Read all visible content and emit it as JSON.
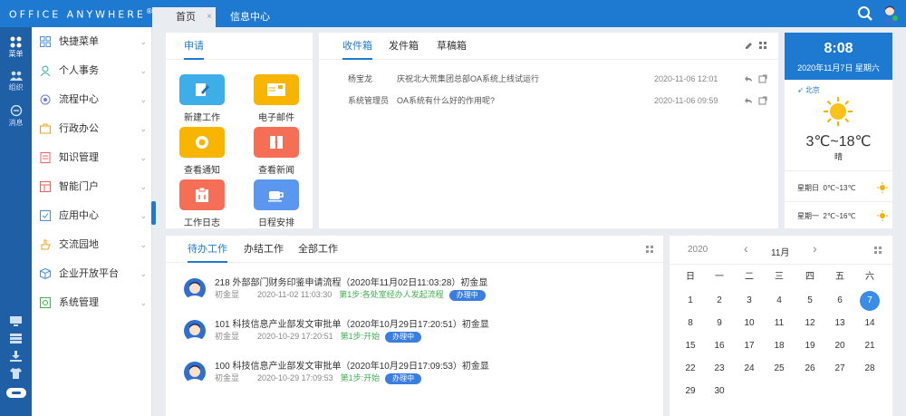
{
  "app": {
    "logo": "OFFICE ANYWHERE",
    "logo_mark": "®"
  },
  "tabs": [
    {
      "label": "首页"
    },
    {
      "label": "信息中心"
    }
  ],
  "leftbar": {
    "items": [
      {
        "label": "菜单"
      },
      {
        "label": "组织"
      },
      {
        "label": "消息"
      }
    ]
  },
  "menu": {
    "items": [
      {
        "label": "快捷菜单",
        "icon": "grid-icon"
      },
      {
        "label": "个人事务",
        "icon": "user-icon"
      },
      {
        "label": "流程中心",
        "icon": "flow-icon"
      },
      {
        "label": "行政办公",
        "icon": "briefcase-icon"
      },
      {
        "label": "知识管理",
        "icon": "book-icon"
      },
      {
        "label": "智能门户",
        "icon": "portal-icon"
      },
      {
        "label": "应用中心",
        "icon": "app-icon"
      },
      {
        "label": "交流园地",
        "icon": "hand-icon"
      },
      {
        "label": "企业开放平台",
        "icon": "cube-icon"
      },
      {
        "label": "系统管理",
        "icon": "settings-icon"
      }
    ]
  },
  "apply": {
    "tab": "申请",
    "apps": [
      {
        "label": "新建工作",
        "color": "#3eaee8"
      },
      {
        "label": "电子邮件",
        "color": "#f7b500"
      },
      {
        "label": "查看通知",
        "color": "#f7b500"
      },
      {
        "label": "查看新闻",
        "color": "#f46f56"
      },
      {
        "label": "工作日志",
        "color": "#f46f56"
      },
      {
        "label": "日程安排",
        "color": "#5b97ee"
      }
    ]
  },
  "mail": {
    "tabs": [
      {
        "label": "收件箱"
      },
      {
        "label": "发件箱"
      },
      {
        "label": "草稿箱"
      }
    ],
    "rows": [
      {
        "sender": "杨宝龙",
        "subject": "庆祝北大荒集团总部OA系统上线试运行",
        "time": "2020-11-06 12:01"
      },
      {
        "sender": "系统管理员",
        "subject": "OA系统有什么好的作用呢?",
        "time": "2020-11-06 09:59"
      }
    ]
  },
  "weather": {
    "time": "8:08",
    "date": "2020年11月7日 星期六",
    "city": "北京",
    "temp": "3℃~18℃",
    "desc": "晴",
    "forecast": [
      {
        "day": "星期日",
        "range": "0℃~13℃"
      },
      {
        "day": "星期一",
        "range": "2℃~16℃"
      }
    ]
  },
  "todo": {
    "tabs": [
      {
        "label": "待办工作"
      },
      {
        "label": "办结工作"
      },
      {
        "label": "全部工作"
      }
    ],
    "items": [
      {
        "title": "218 外部部门财务印鉴申请流程（2020年11月02日11:03:28）初金显",
        "user": "初金显",
        "time": "2020-11-02 11:03:30",
        "step": "第1步:各处室经办人发起流程",
        "status": "办理中"
      },
      {
        "title": "101 科技信息产业部发文审批单（2020年10月29日17:20:51）初金显",
        "user": "初金显",
        "time": "2020-10-29 17:20:51",
        "step": "第1步:开始",
        "status": "办理中"
      },
      {
        "title": "100 科技信息产业部发文审批单（2020年10月29日17:09:53）初金显",
        "user": "初金显",
        "time": "2020-10-29 17:09:53",
        "step": "第1步:开始",
        "status": "办理中"
      }
    ]
  },
  "calendar": {
    "year": "2020",
    "month": "11月",
    "prev": "‹",
    "next": "›",
    "weekdays": [
      "日",
      "一",
      "二",
      "三",
      "四",
      "五",
      "六"
    ],
    "days": [
      "1",
      "2",
      "3",
      "4",
      "5",
      "6",
      "7",
      "8",
      "9",
      "10",
      "11",
      "12",
      "13",
      "14",
      "15",
      "16",
      "17",
      "18",
      "19",
      "20",
      "21",
      "22",
      "23",
      "24",
      "25",
      "26",
      "27",
      "28",
      "29",
      "30"
    ],
    "today": "7"
  },
  "colors": {
    "primary": "#1e7ad0",
    "sidebar": "#1f5fa6",
    "success": "#3fb34f",
    "badge": "#3a7ee0"
  }
}
